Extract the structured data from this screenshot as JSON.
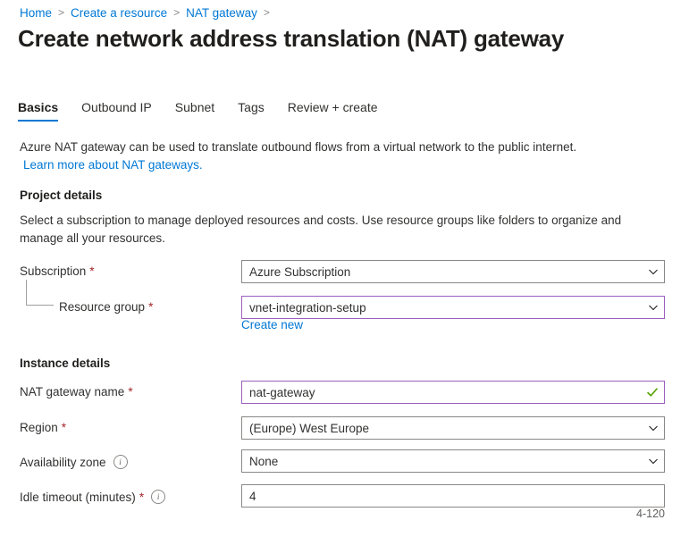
{
  "breadcrumb": {
    "items": [
      {
        "label": "Home"
      },
      {
        "label": "Create a resource"
      },
      {
        "label": "NAT gateway"
      }
    ],
    "separator": ">"
  },
  "header": {
    "title": "Create network address translation (NAT) gateway",
    "more_menu": "···"
  },
  "tabs": [
    {
      "label": "Basics",
      "active": true
    },
    {
      "label": "Outbound IP",
      "active": false
    },
    {
      "label": "Subnet",
      "active": false
    },
    {
      "label": "Tags",
      "active": false
    },
    {
      "label": "Review + create",
      "active": false
    }
  ],
  "intro": {
    "text": "Azure NAT gateway can be used to translate outbound flows from a virtual network to the public internet.",
    "link": "Learn more about NAT gateways."
  },
  "project_details": {
    "heading": "Project details",
    "description": "Select a subscription to manage deployed resources and costs. Use resource groups like folders to organize and manage all your resources.",
    "subscription": {
      "label": "Subscription",
      "required": "*",
      "value": "Azure Subscription"
    },
    "resource_group": {
      "label": "Resource group",
      "required": "*",
      "value": "vnet-integration-setup",
      "create_new_link": "Create new"
    }
  },
  "instance_details": {
    "heading": "Instance details",
    "nat_gateway_name": {
      "label": "NAT gateway name",
      "required": "*",
      "value": "nat-gateway"
    },
    "region": {
      "label": "Region",
      "required": "*",
      "value": "(Europe) West Europe"
    },
    "availability_zone": {
      "label": "Availability zone",
      "value": "None"
    },
    "idle_timeout": {
      "label": "Idle timeout (minutes)",
      "required": "*",
      "value": "4",
      "hint": "4-120"
    }
  },
  "colors": {
    "link": "#0078d4",
    "accent_underline": "#0078d4",
    "required_asterisk": "#a4262c",
    "focus_border": "#9b5fbf",
    "valid_check": "#57a300",
    "field_border": "#8a8886"
  }
}
